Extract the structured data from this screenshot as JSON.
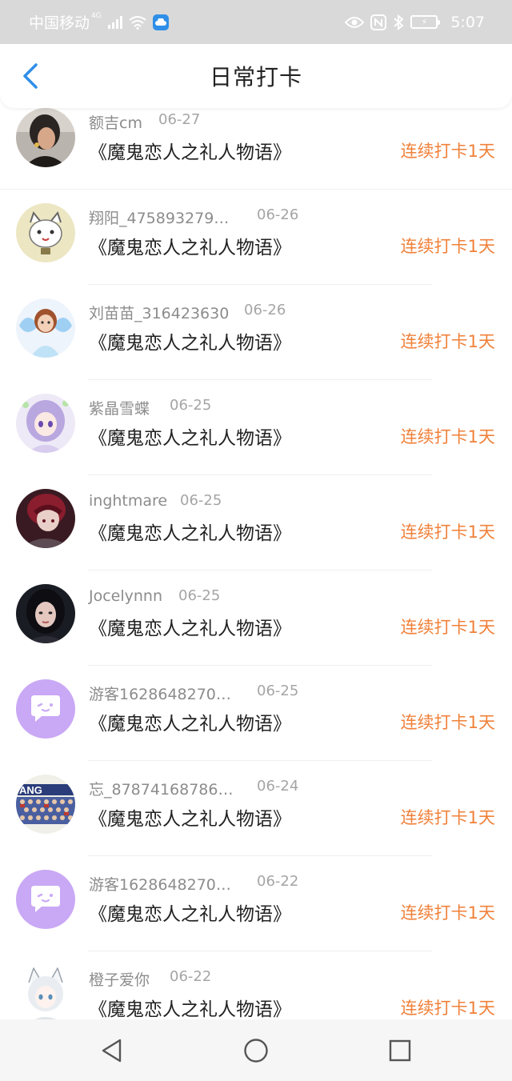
{
  "status_bar": {
    "carrier": "中国移动",
    "network": "4G",
    "time": "5:07"
  },
  "header": {
    "title": "日常打卡",
    "back_icon": "chevron-left-icon"
  },
  "checkins": [
    {
      "name": "额吉cm",
      "date": "06-27",
      "book": "《魔鬼恋人之礼人物语》",
      "streak": "连续打卡1天",
      "avatar": "photo-girl"
    },
    {
      "name": "翔阳_475893279…",
      "date": "06-26",
      "book": "《魔鬼恋人之礼人物语》",
      "streak": "连续打卡1天",
      "avatar": "cat-cartoon"
    },
    {
      "name": "刘苗苗_316423630",
      "date": "06-26",
      "book": "《魔鬼恋人之礼人物语》",
      "streak": "连续打卡1天",
      "avatar": "fairy-doll"
    },
    {
      "name": "紫晶雪蝶",
      "date": "06-25",
      "book": "《魔鬼恋人之礼人物语》",
      "streak": "连续打卡1天",
      "avatar": "anime-purple"
    },
    {
      "name": "inghtmare",
      "date": "06-25",
      "book": "《魔鬼恋人之礼人物语》",
      "streak": "连续打卡1天",
      "avatar": "anime-dark"
    },
    {
      "name": "Jocelynnn",
      "date": "06-25",
      "book": "《魔鬼恋人之礼人物语》",
      "streak": "连续打卡1天",
      "avatar": "photo-dark"
    },
    {
      "name": "游客1628648270…",
      "date": "06-25",
      "book": "《魔鬼恋人之礼人物语》",
      "streak": "连续打卡1天",
      "avatar": "guest-bubble"
    },
    {
      "name": "忘_87874168786…",
      "date": "06-24",
      "book": "《魔鬼恋人之礼人物语》",
      "streak": "连续打卡1天",
      "avatar": "group-photo"
    },
    {
      "name": "游客1628648270…",
      "date": "06-22",
      "book": "《魔鬼恋人之礼人物语》",
      "streak": "连续打卡1天",
      "avatar": "guest-bubble"
    },
    {
      "name": "橙子爱你",
      "date": "06-22",
      "book": "《魔鬼恋人之礼人物语》",
      "streak": "连续打卡1天",
      "avatar": "anime-catgirl"
    }
  ],
  "colors": {
    "streak": "#f0813a",
    "accent": "#2f8fe8",
    "guest_avatar": "#c9a8f5"
  },
  "nav": [
    "back-triangle-icon",
    "home-circle-icon",
    "recents-square-icon"
  ]
}
